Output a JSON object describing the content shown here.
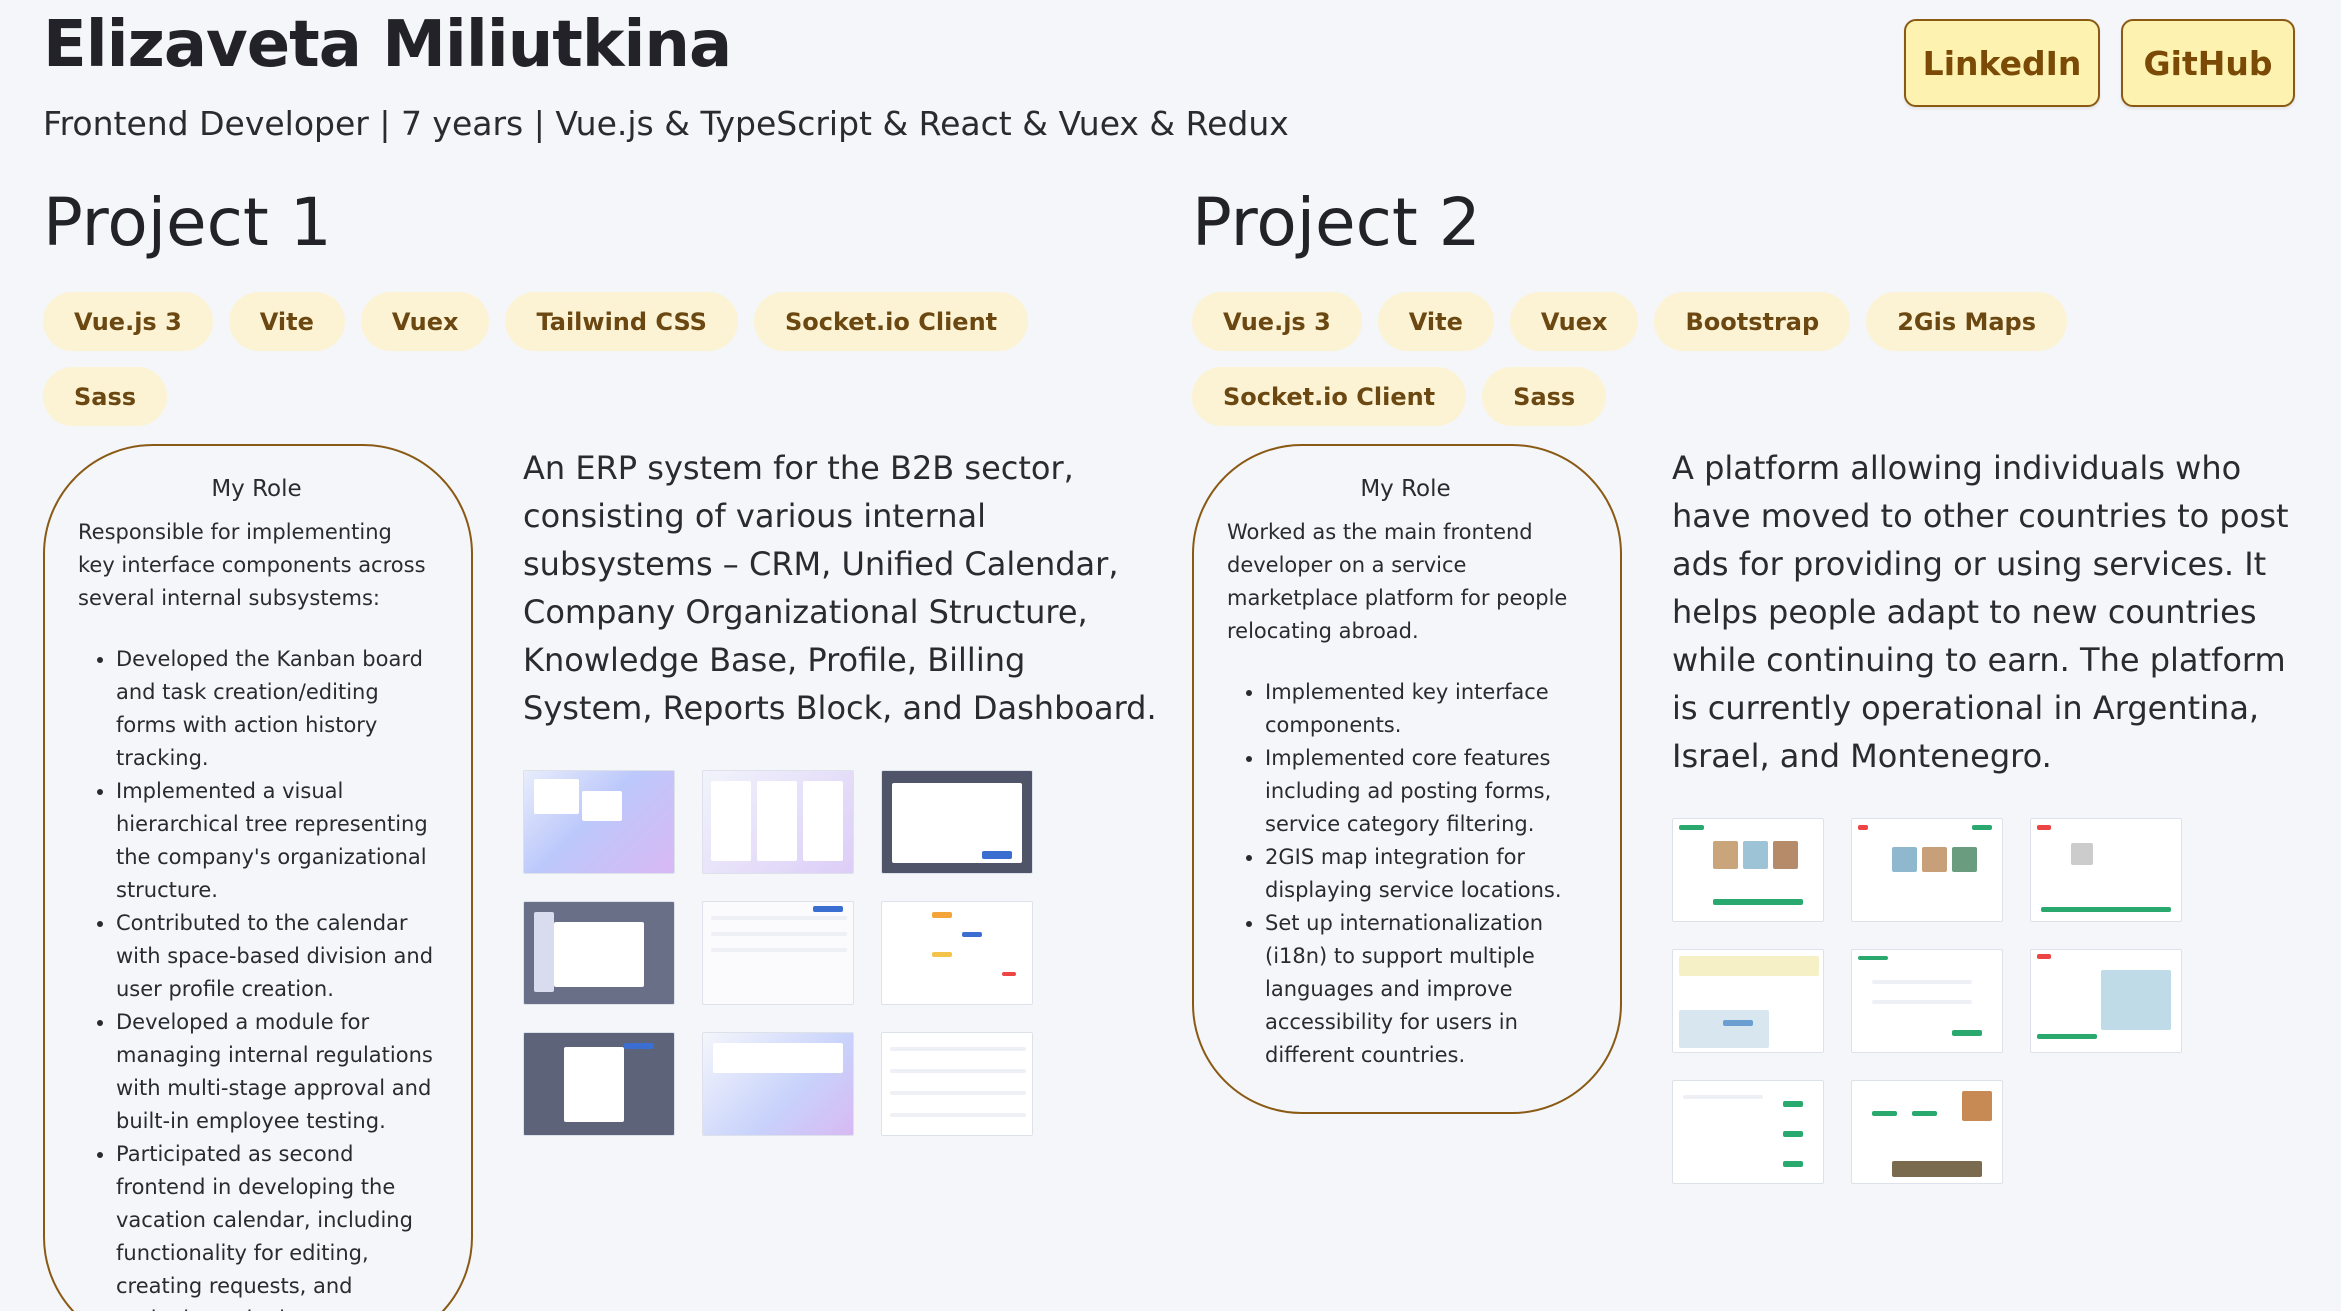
{
  "header": {
    "name": "Elizaveta Miliutkina",
    "tagline": "Frontend Developer | 7 years | Vue.js & TypeScript & React & Vuex & Redux",
    "links": [
      {
        "label": "LinkedIn"
      },
      {
        "label": "GitHub"
      }
    ]
  },
  "colors": {
    "accent_border": "#8a5a14",
    "button_bg": "#fdf2b0",
    "tag_bg": "#fbf3d3",
    "tag_text": "#6b4712",
    "page_bg": "#f4f6fa"
  },
  "projects": [
    {
      "title": "Project 1",
      "tags": [
        "Vue.js 3",
        "Vite",
        "Vuex",
        "Tailwind CSS",
        "Socket.io Client",
        "Sass"
      ],
      "role": {
        "title": "My Role",
        "intro": "Responsible for implementing key interface components across several internal subsystems:",
        "items": [
          "Developed the Kanban board and task creation/editing forms with action history tracking.",
          "Implemented a visual hierarchical tree representing the company's organizational structure.",
          "Contributed to the calendar with space-based division and user profile creation.",
          "Developed a module for managing internal regulations with multi-stage approval and built-in employee testing.",
          "Participated as second frontend in developing the vacation calendar, including functionality for editing, creating requests, and assigning substitutes."
        ]
      },
      "description": "An ERP system for the B2B sector, consisting of various internal subsystems – CRM, Unified Calendar, Company Organizational Structure, Knowledge Base, Profile, Billing System, Reports Block, and Dashboard.",
      "screenshots_count": 9
    },
    {
      "title": "Project 2",
      "tags": [
        "Vue.js 3",
        "Vite",
        "Vuex",
        "Bootstrap",
        "2Gis Maps",
        "Socket.io Client",
        "Sass"
      ],
      "role": {
        "title": "My Role",
        "intro": "Worked as the main frontend developer on a service marketplace platform for people relocating abroad.",
        "items": [
          "Implemented key interface components.",
          "Implemented core features including ad posting forms, service category filtering.",
          "2GIS map integration for displaying service locations.",
          "Set up internationalization (i18n) to support multiple languages and improve accessibility for users in different countries."
        ]
      },
      "description": "A platform allowing individuals who have moved to other countries to post ads for providing or using services. It helps people adapt to new countries while continuing to earn. The platform is currently operational in Argentina, Israel, and Montenegro.",
      "screenshots_count": 8
    }
  ]
}
